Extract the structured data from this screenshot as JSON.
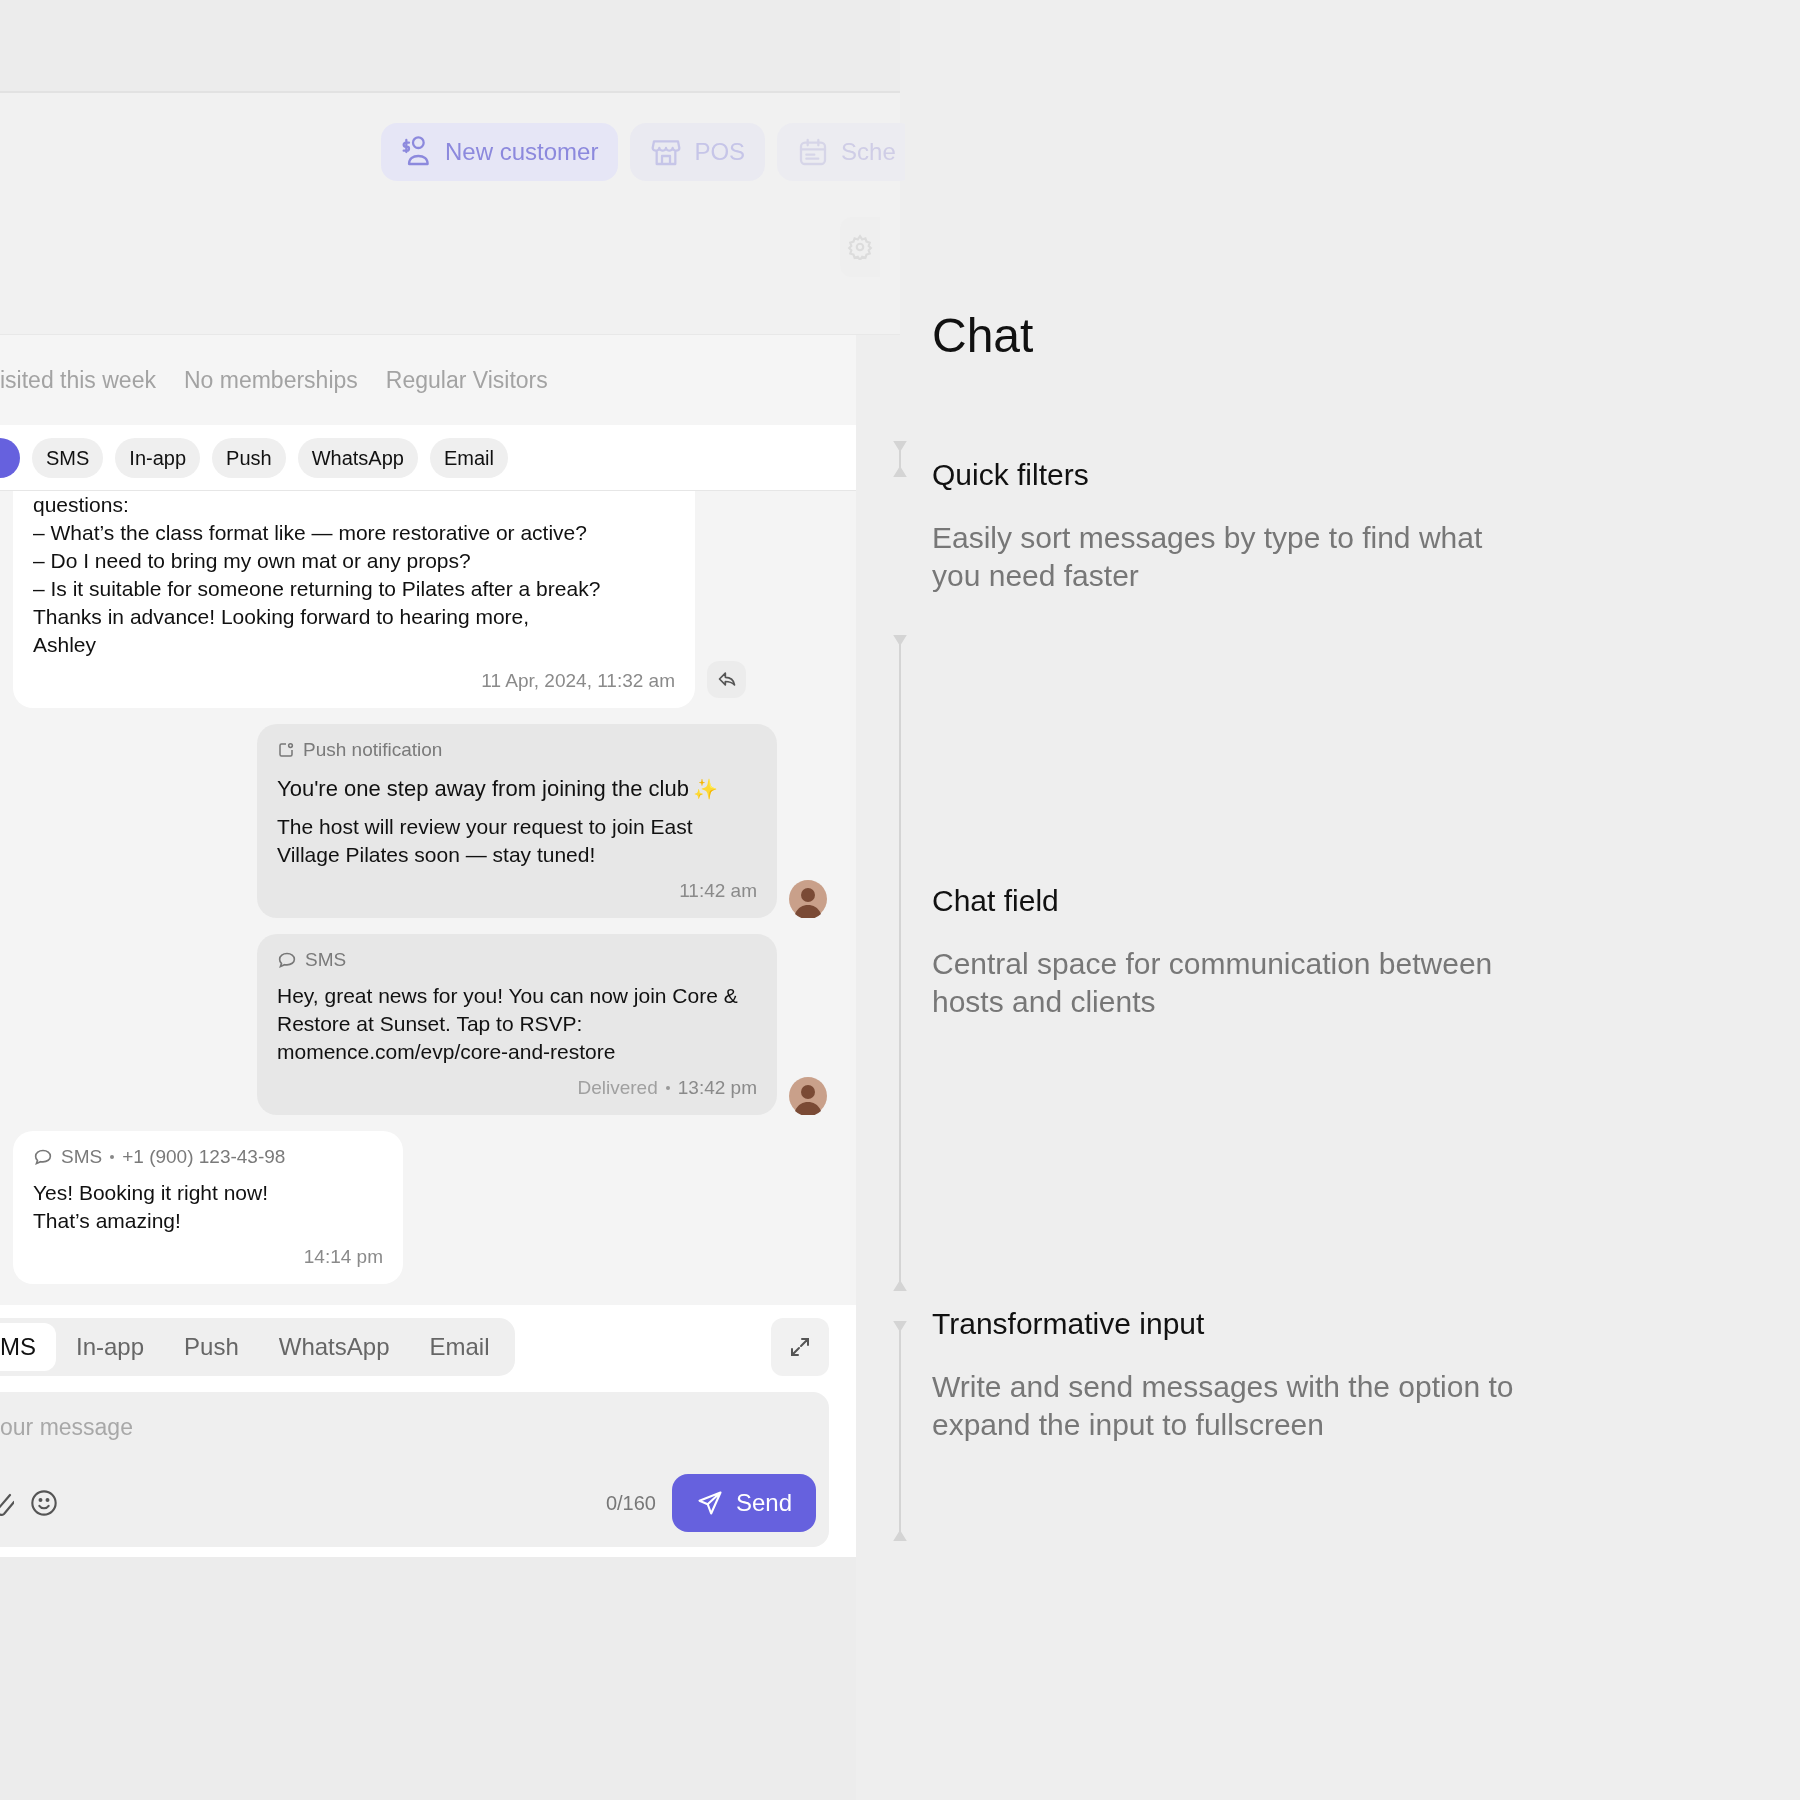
{
  "header": {
    "buttons": [
      {
        "label": "New customer"
      },
      {
        "label": "POS"
      },
      {
        "label": "Sche"
      }
    ]
  },
  "segments": [
    "isited this week",
    "No memberships",
    "Regular Visitors"
  ],
  "filters": [
    {
      "selected": true
    },
    {
      "label": "SMS",
      "selected": false
    },
    {
      "label": "In-app",
      "selected": false
    },
    {
      "label": "Push",
      "selected": false
    },
    {
      "label": "WhatsApp",
      "selected": false
    },
    {
      "label": "Email",
      "selected": false
    }
  ],
  "messages": [
    {
      "kind": "incoming",
      "body": "questions:\n – What’s the class format like — more restorative or active?\n – Do I need to bring my own mat or any props?\n – Is it suitable for someone returning to Pilates after a break?\nThanks in advance! Looking forward to hearing more,\nAshley",
      "time": "11 Apr, 2024, 11:32 am",
      "reply": true
    },
    {
      "kind": "outgoing",
      "channel_label": "Push notification",
      "title": "You're one step away from joining the club",
      "title_emoji": "✨",
      "body": "The host will review your request to join East Village Pilates soon — stay tuned!",
      "time": "11:42 am"
    },
    {
      "kind": "outgoing",
      "channel_label": "SMS",
      "body": "Hey, great news for you! You can now join Core & Restore at Sunset. Tap to RSVP: momence.com/evp/core-and-restore",
      "status": "Delivered",
      "time": "13:42 pm"
    },
    {
      "kind": "incoming",
      "channel_label": "SMS",
      "sender": "+1 (900) 123-43-98",
      "body": "Yes! Booking it right now!\nThat’s amazing!",
      "time": "14:14 pm"
    }
  ],
  "composer": {
    "tabs": [
      {
        "label": "MS",
        "selected": true
      },
      {
        "label": "In-app",
        "selected": false
      },
      {
        "label": "Push",
        "selected": false
      },
      {
        "label": "WhatsApp",
        "selected": false
      },
      {
        "label": "Email",
        "selected": false
      }
    ],
    "placeholder": "our message",
    "counter": "0/160",
    "send": "Send"
  },
  "annotations": {
    "title": "Chat",
    "sections": [
      {
        "heading": "Quick filters",
        "description": "Easily sort messages by type to find what you need faster"
      },
      {
        "heading": "Chat field",
        "description": "Central space for communication between hosts and clients"
      },
      {
        "heading": "Transformative input",
        "description": "Write and send messages with the option to expand the input to fullscreen"
      }
    ]
  }
}
